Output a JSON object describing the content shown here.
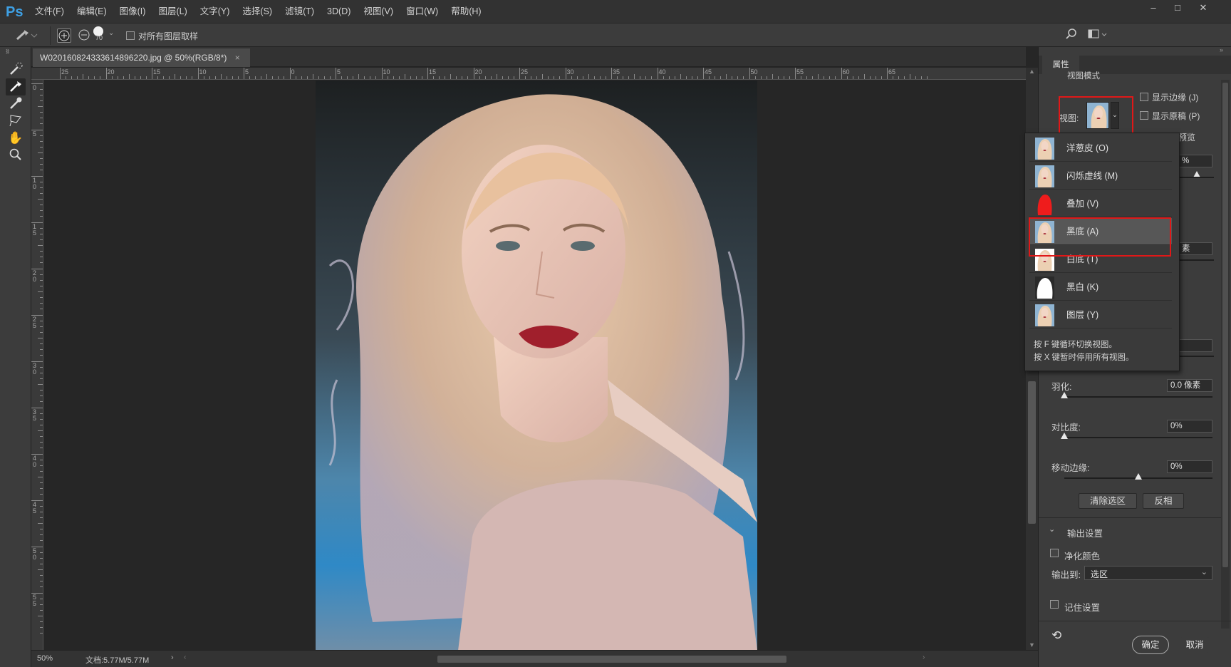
{
  "app": {
    "logo": "Ps"
  },
  "menu": [
    "文件(F)",
    "编辑(E)",
    "图像(I)",
    "图层(L)",
    "文字(Y)",
    "选择(S)",
    "滤镜(T)",
    "3D(D)",
    "视图(V)",
    "窗口(W)",
    "帮助(H)"
  ],
  "options": {
    "brush_size": "70",
    "sample_all_layers_label": "对所有图层取样"
  },
  "document": {
    "tab_title": "W020160824333614896220.jpg @ 50%(RGB/8*)",
    "close_glyph": "×"
  },
  "ruler": {
    "h_ticks": [
      "25",
      "20",
      "15",
      "10",
      "5",
      "0",
      "5",
      "10",
      "15",
      "20",
      "25",
      "30",
      "35",
      "40",
      "45",
      "50",
      "55",
      "60",
      "65"
    ],
    "v_ticks": [
      "0",
      "5",
      "10",
      "15",
      "20",
      "25",
      "30",
      "35",
      "40",
      "45",
      "50",
      "55"
    ]
  },
  "status": {
    "zoom": "50%",
    "doc_info": "文档:5.77M/5.77M",
    "arrow": "›"
  },
  "panel": {
    "tab": "属性",
    "section_view_mode": "视图模式",
    "view_label": "视图:",
    "show_edge": "显示边缘 (J)",
    "show_original": "显示原稿 (P)",
    "high_quality_preview_fragment": "预览",
    "percent_fragment": "%",
    "pixel_fragment": "素",
    "feather_label": "羽化:",
    "feather_value": "0.0 像素",
    "feather_level": 0,
    "contrast_label": "对比度:",
    "contrast_value": "0%",
    "contrast_level": 0,
    "shift_edge_label": "移动边缘:",
    "shift_edge_value": "0%",
    "shift_edge_level": 0.5,
    "clear_selection": "清除选区",
    "invert": "反相",
    "output_settings": "输出设置",
    "decontaminate": "净化颜色",
    "output_to_label": "输出到:",
    "output_to_value": "选区",
    "remember": "记住设置",
    "ok": "确定",
    "cancel": "取消"
  },
  "view_dropdown": {
    "items": [
      {
        "label": "洋葱皮 (O)",
        "thumb": "portrait"
      },
      {
        "label": "闪烁虚线 (M)",
        "thumb": "portrait"
      },
      {
        "label": "叠加 (V)",
        "thumb": "red-overlay"
      },
      {
        "label": "黑底 (A)",
        "thumb": "portrait"
      },
      {
        "label": "白底 (T)",
        "thumb": "portrait-white"
      },
      {
        "label": "黑白 (K)",
        "thumb": "bw-mask"
      },
      {
        "label": "图层 (Y)",
        "thumb": "portrait"
      }
    ],
    "selected_index": 3,
    "hint_1": "按 F 键循环切换视图。",
    "hint_2": "按 X 键暂时停用所有视图。"
  },
  "colors": {
    "highlight_box": "#e01818",
    "accent": "#3ea0e4"
  }
}
